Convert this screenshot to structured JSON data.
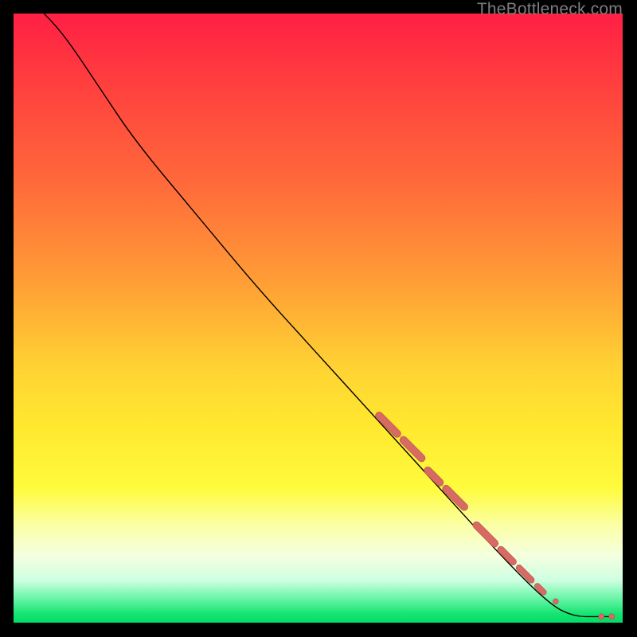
{
  "attribution": "TheBottleneck.com",
  "colors": {
    "gradient_top": "#ff1f44",
    "gradient_mid": "#ffe92f",
    "gradient_bottom": "#00dd66",
    "curve": "#000000",
    "marker_fill": "#d76a63",
    "marker_stroke": "#b84f49",
    "page_bg": "#000000"
  },
  "chart_data": {
    "type": "line",
    "title": "",
    "xlabel": "",
    "ylabel": "",
    "xlim": [
      0,
      100
    ],
    "ylim": [
      0,
      100
    ],
    "grid": false,
    "legend": false,
    "curve": [
      {
        "x": 5,
        "y": 100
      },
      {
        "x": 7,
        "y": 98
      },
      {
        "x": 10,
        "y": 94
      },
      {
        "x": 14,
        "y": 88
      },
      {
        "x": 20,
        "y": 79
      },
      {
        "x": 30,
        "y": 67
      },
      {
        "x": 40,
        "y": 55
      },
      {
        "x": 50,
        "y": 44
      },
      {
        "x": 60,
        "y": 33
      },
      {
        "x": 70,
        "y": 22
      },
      {
        "x": 80,
        "y": 11
      },
      {
        "x": 88,
        "y": 3
      },
      {
        "x": 92,
        "y": 1
      },
      {
        "x": 96,
        "y": 1
      },
      {
        "x": 98,
        "y": 1
      }
    ],
    "marker_segments": [
      {
        "x1": 60,
        "y1": 34,
        "x2": 63,
        "y2": 31,
        "r": 4.6
      },
      {
        "x1": 64,
        "y1": 30,
        "x2": 67,
        "y2": 27,
        "r": 4.6
      },
      {
        "x1": 68,
        "y1": 25,
        "x2": 70,
        "y2": 23,
        "r": 4.6
      },
      {
        "x1": 71,
        "y1": 22,
        "x2": 74,
        "y2": 19,
        "r": 4.6
      },
      {
        "x1": 76,
        "y1": 16,
        "x2": 79,
        "y2": 13,
        "r": 4.6
      },
      {
        "x1": 80,
        "y1": 12,
        "x2": 82,
        "y2": 10,
        "r": 4.2
      },
      {
        "x1": 83,
        "y1": 9,
        "x2": 85,
        "y2": 7,
        "r": 3.8
      },
      {
        "x1": 86,
        "y1": 6,
        "x2": 87,
        "y2": 5,
        "r": 3.6
      }
    ],
    "marker_points": [
      {
        "x": 89,
        "y": 3.5,
        "r": 3.4
      },
      {
        "x": 96.5,
        "y": 1,
        "r": 3.6
      },
      {
        "x": 98.2,
        "y": 1,
        "r": 3.6
      }
    ]
  }
}
